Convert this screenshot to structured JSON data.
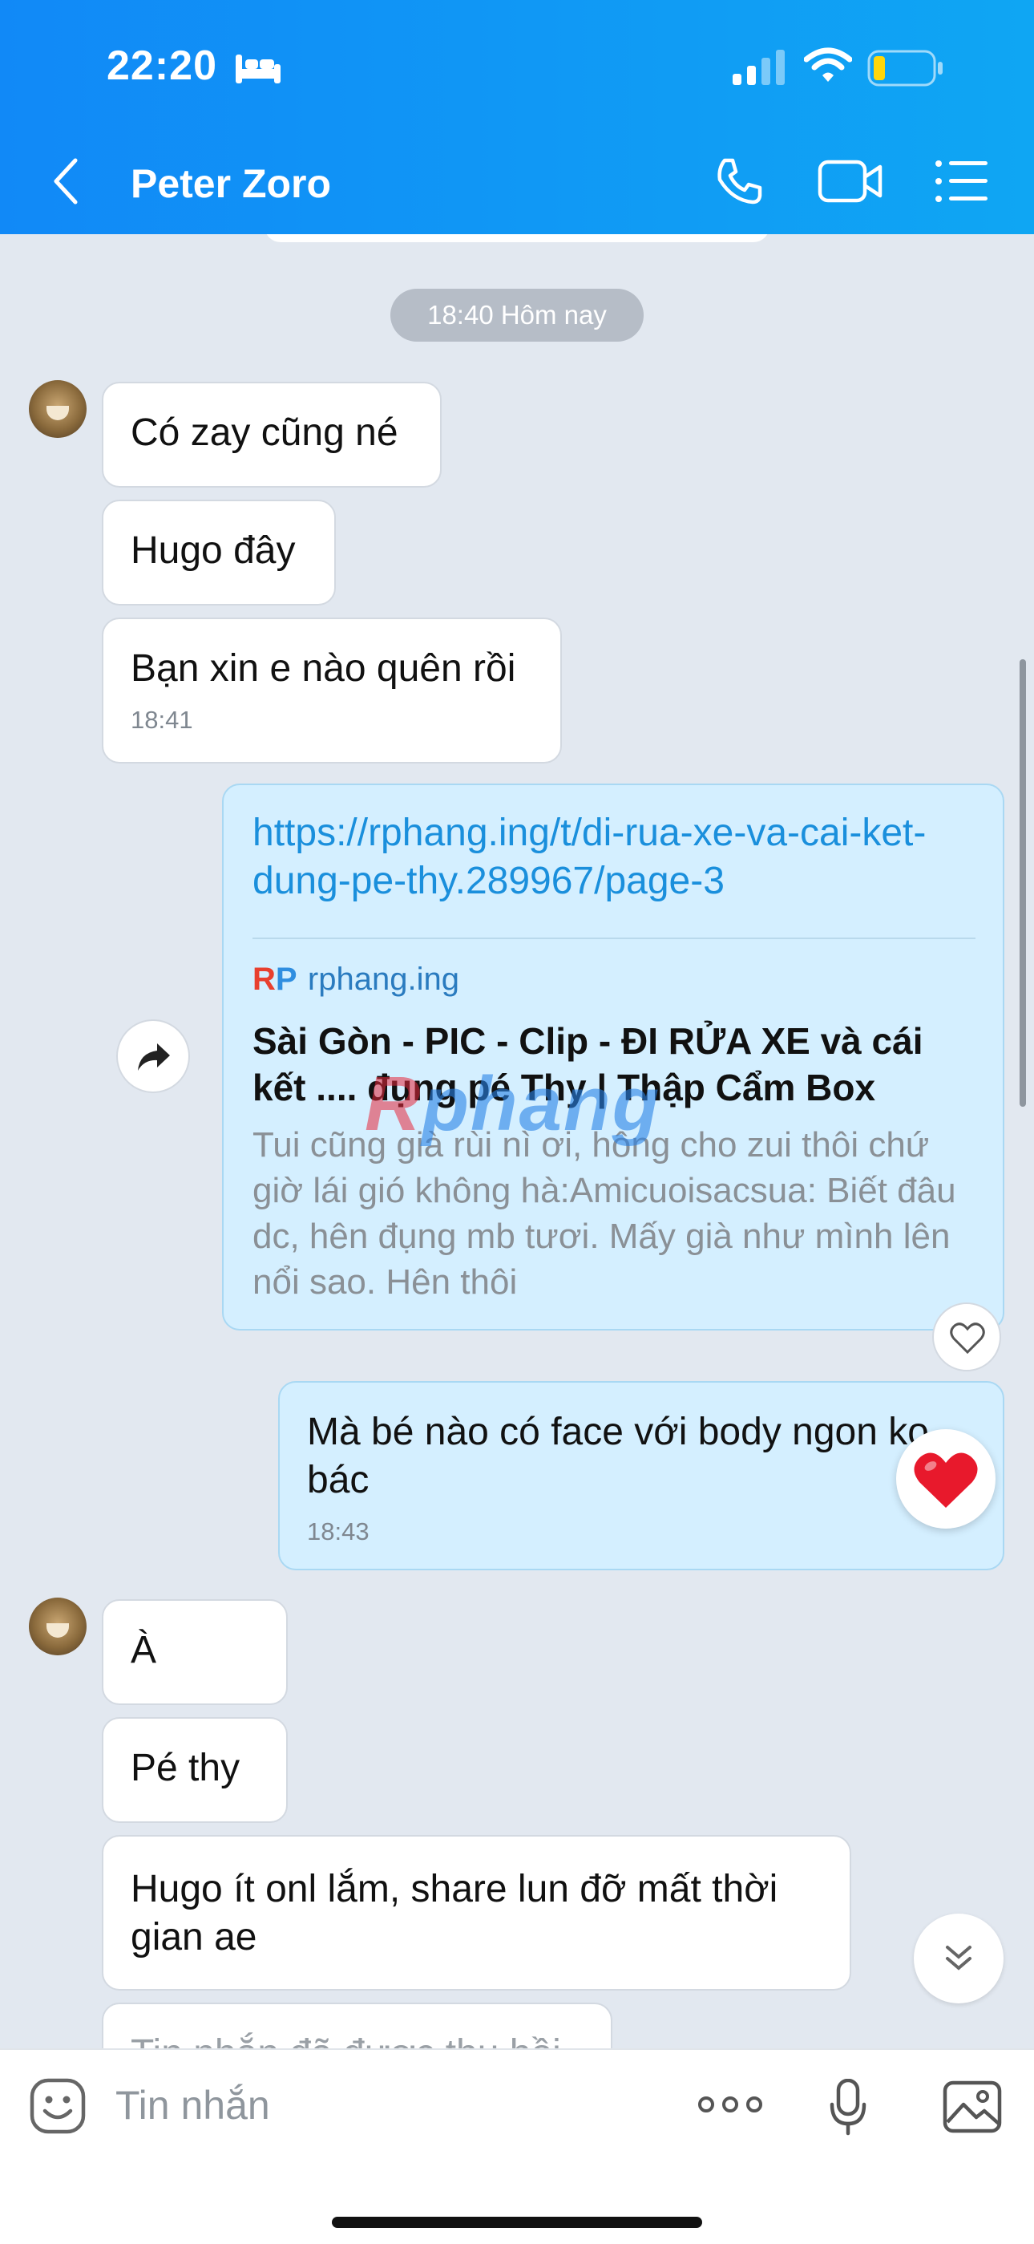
{
  "status_bar": {
    "time": "22:20"
  },
  "header": {
    "title": "Peter Zoro"
  },
  "chat": {
    "time_pill": "18:40 Hôm nay",
    "group1": [
      {
        "text": "Có zay cũng né"
      },
      {
        "text": "Hugo đây"
      },
      {
        "text": "Bạn xin e nào quên rồi",
        "time": "18:41"
      }
    ],
    "link_card": {
      "url": "https://rphang.ing/t/di-rua-xe-va-cai-ket-dung-pe-thy.289967/page-3",
      "logo": "RP",
      "domain": "rphang.ing",
      "title": "Sài Gòn - PIC - Clip - ĐI RỬA XE và cái kết .... đụng pé Thy | Thập Cẩm Box",
      "description": "Tui cũng già rùi nì ơi, hông cho zui thôi chứ giờ lái gió không hà:Amicuoisacsua: Biết đâu dc, hên đụng mb tươi. Mấy già như mình lên nổi sao. Hên thôi"
    },
    "sent_message": {
      "text": "Mà bé nào có face với body ngon ko bác",
      "time": "18:43"
    },
    "group2": [
      {
        "text": "À"
      },
      {
        "text": "Pé thy"
      },
      {
        "text": "Hugo ít onl lắm, share lun đỡ mất thời gian ae"
      },
      {
        "text": "Tin nhắn đã được thu hồi"
      }
    ],
    "watermark": {
      "part1": "R",
      "part2": "phang"
    },
    "colors": {
      "header_start": "#1189f7",
      "header_end": "#0fa6f3",
      "sent_bubble": "#d4efff",
      "link": "#1a8fdc",
      "reaction_heart": "#e8192c"
    }
  },
  "composer": {
    "placeholder": "Tin nhắn"
  },
  "icons": [
    "bed-icon",
    "signal-icon",
    "wifi-icon",
    "battery-icon",
    "back-icon",
    "phone-icon",
    "video-call-icon",
    "menu-icon",
    "share-icon",
    "heart-outline-icon",
    "heart-reaction-icon",
    "chevrons-down-icon",
    "emoji-icon",
    "more-icon",
    "mic-icon",
    "image-icon"
  ]
}
